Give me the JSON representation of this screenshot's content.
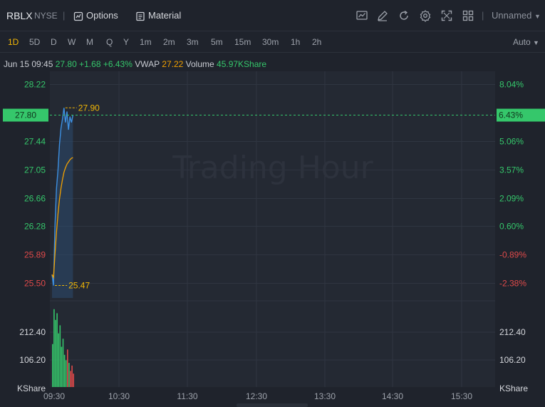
{
  "header": {
    "symbol": "RBLX",
    "exchange": "NYSE",
    "options_label": "Options",
    "material_label": "Material",
    "layout_name": "Unnamed",
    "icons": [
      "chart-type-icon",
      "draw-icon",
      "refresh-icon",
      "settings-icon",
      "fullscreen-icon",
      "layout-grid-icon"
    ]
  },
  "intervals": [
    "1D",
    "5D",
    "D",
    "W",
    "M",
    "Q",
    "Y",
    "1m",
    "2m",
    "3m",
    "5m",
    "15m",
    "30m",
    "1h",
    "2h"
  ],
  "active_interval": "1D",
  "scale_mode": "Auto",
  "info_bar": {
    "datetime": "Jun 15 09:45",
    "price": "27.80",
    "change": "+1.68",
    "change_pct": "+6.43%",
    "vwap_label": "VWAP",
    "vwap": "27.22",
    "volume_label": "Volume",
    "volume": "45.97KShare"
  },
  "watermark": "Trading Hour",
  "colors": {
    "up": "#35c76b",
    "down": "#e04a4a",
    "vwap": "#f2a100",
    "price_line": "#3d8fe0",
    "active": "#f2b705"
  },
  "chart_data": {
    "type": "line",
    "y_left_ticks": [
      {
        "label": "28.22",
        "value": 28.22
      },
      {
        "label": "27.44",
        "value": 27.44
      },
      {
        "label": "27.05",
        "value": 27.05
      },
      {
        "label": "26.66",
        "value": 26.66
      },
      {
        "label": "26.28",
        "value": 26.28
      },
      {
        "label": "25.89",
        "value": 25.89
      },
      {
        "label": "25.50",
        "value": 25.5
      }
    ],
    "y_right_ticks": [
      {
        "label": "8.04%",
        "value": 28.22
      },
      {
        "label": "5.06%",
        "value": 27.44
      },
      {
        "label": "3.57%",
        "value": 27.05
      },
      {
        "label": "2.09%",
        "value": 26.66
      },
      {
        "label": "0.60%",
        "value": 26.28
      },
      {
        "label": "-0.89%",
        "value": 25.89
      },
      {
        "label": "-2.38%",
        "value": 25.5
      }
    ],
    "ylim": [
      25.3,
      28.4
    ],
    "current_price": {
      "value": 27.8,
      "label": "27.80",
      "pct_label": "6.43%"
    },
    "high": {
      "value": 27.9,
      "label": "27.90"
    },
    "low": {
      "value": 25.47,
      "label": "25.47"
    },
    "x_ticks": [
      "09:30",
      "10:30",
      "11:30",
      "12:30",
      "13:30",
      "14:30",
      "15:30"
    ],
    "x_range": [
      "09:30",
      "16:00"
    ],
    "price_series": [
      {
        "t": 0,
        "v": 25.62
      },
      {
        "t": 1,
        "v": 25.47
      },
      {
        "t": 2,
        "v": 26.3
      },
      {
        "t": 3,
        "v": 26.8
      },
      {
        "t": 4,
        "v": 27.05
      },
      {
        "t": 5,
        "v": 27.4
      },
      {
        "t": 6,
        "v": 27.62
      },
      {
        "t": 7,
        "v": 27.75
      },
      {
        "t": 8,
        "v": 27.9
      },
      {
        "t": 9,
        "v": 27.7
      },
      {
        "t": 10,
        "v": 27.85
      },
      {
        "t": 11,
        "v": 27.6
      },
      {
        "t": 12,
        "v": 27.78
      },
      {
        "t": 13,
        "v": 27.7
      },
      {
        "t": 14,
        "v": 27.8
      }
    ],
    "vwap_series": [
      {
        "t": 0,
        "v": 25.62
      },
      {
        "t": 1,
        "v": 25.58
      },
      {
        "t": 2,
        "v": 25.9
      },
      {
        "t": 3,
        "v": 26.2
      },
      {
        "t": 4,
        "v": 26.45
      },
      {
        "t": 5,
        "v": 26.65
      },
      {
        "t": 6,
        "v": 26.8
      },
      {
        "t": 7,
        "v": 26.92
      },
      {
        "t": 8,
        "v": 27.02
      },
      {
        "t": 9,
        "v": 27.08
      },
      {
        "t": 10,
        "v": 27.13
      },
      {
        "t": 11,
        "v": 27.16
      },
      {
        "t": 12,
        "v": 27.19
      },
      {
        "t": 13,
        "v": 27.21
      },
      {
        "t": 14,
        "v": 27.22
      }
    ],
    "volume_axis": {
      "ticks": [
        {
          "label": "212.40",
          "value": 212.4
        },
        {
          "label": "106.20",
          "value": 106.2
        }
      ],
      "unit": "KShare",
      "max": 300
    },
    "volume_series": [
      {
        "t": 0,
        "v": 160,
        "dir": "up"
      },
      {
        "t": 1,
        "v": 290,
        "dir": "up"
      },
      {
        "t": 2,
        "v": 250,
        "dir": "up"
      },
      {
        "t": 3,
        "v": 275,
        "dir": "up"
      },
      {
        "t": 4,
        "v": 200,
        "dir": "up"
      },
      {
        "t": 5,
        "v": 230,
        "dir": "up"
      },
      {
        "t": 6,
        "v": 150,
        "dir": "up"
      },
      {
        "t": 7,
        "v": 180,
        "dir": "up"
      },
      {
        "t": 8,
        "v": 120,
        "dir": "up"
      },
      {
        "t": 9,
        "v": 100,
        "dir": "up"
      },
      {
        "t": 10,
        "v": 140,
        "dir": "down"
      },
      {
        "t": 11,
        "v": 90,
        "dir": "up"
      },
      {
        "t": 12,
        "v": 60,
        "dir": "down"
      },
      {
        "t": 13,
        "v": 80,
        "dir": "down"
      },
      {
        "t": 14,
        "v": 50,
        "dir": "down"
      }
    ]
  }
}
